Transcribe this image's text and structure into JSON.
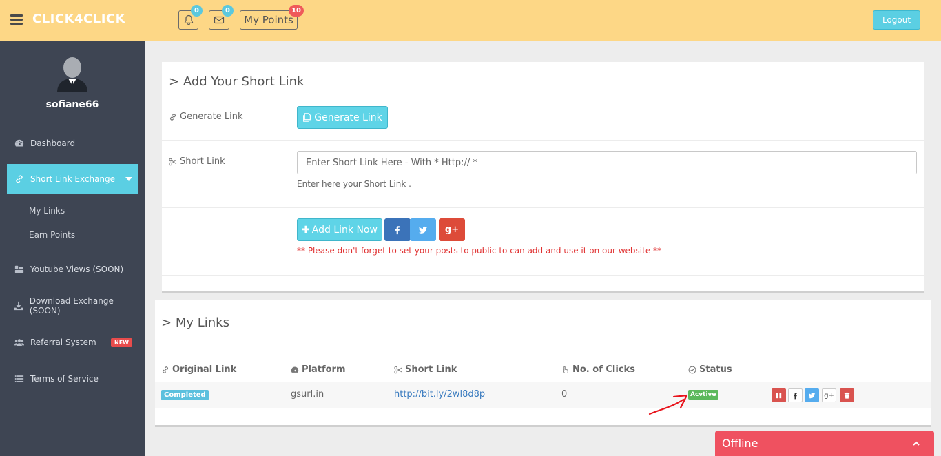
{
  "header": {
    "logo": "CLICK4CLICK",
    "notifications_count": "0",
    "messages_count": "0",
    "points_label": "My Points",
    "points_count": "10",
    "logout_label": "Logout"
  },
  "sidebar": {
    "username": "sofiane66",
    "items": [
      {
        "label": "Dashboard",
        "icon": "dashboard-icon"
      },
      {
        "label": "Short Link Exchange",
        "icon": "link-icon",
        "active": true
      },
      {
        "label": "Youtube Views (SOON)",
        "icon": "youtube-icon"
      },
      {
        "label": "Download Exchange (SOON)",
        "icon": "download-icon"
      },
      {
        "label": "Referral System",
        "icon": "users-icon",
        "badge": "NEW"
      },
      {
        "label": "Terms of Service",
        "icon": "list-icon"
      }
    ],
    "subitems": [
      "My Links",
      "Earn Points"
    ]
  },
  "add_panel": {
    "title": "Add Your Short Link",
    "generate_label": "Generate Link",
    "generate_button": "Generate Link",
    "short_link_label": "Short Link",
    "input_placeholder": "Enter Short Link Here - With * Http:// *",
    "help_text": "Enter here your Short Link .",
    "add_button": "Add Link Now",
    "warning": "** Please don't forget to set your posts to public to can add and use it on our website **"
  },
  "links_panel": {
    "title": "My Links",
    "columns": [
      "Original Link",
      "Platform",
      "Short Link",
      "No. of Clicks",
      "Status"
    ],
    "rows": [
      {
        "original": "Completed",
        "platform": "gsurl.in",
        "short_link": "http://bit.ly/2wl8d8p",
        "clicks": "0",
        "status": "Acvtive"
      }
    ]
  },
  "chat": {
    "status": "Offline"
  },
  "colors": {
    "header_bg": "#fdd786",
    "sidebar_bg": "#3e4553",
    "accent": "#5bcfe3",
    "danger": "#d9534f",
    "facebook": "#3b73b9",
    "twitter": "#55acee",
    "google": "#dd4b39"
  }
}
